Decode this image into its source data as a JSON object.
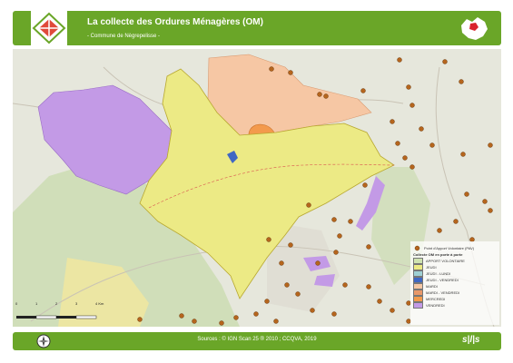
{
  "header": {
    "title": "La collecte des Ordures Ménagères (OM)",
    "subtitle": "- Commune de Nègrepelisse -"
  },
  "footer": {
    "sources": "Sources : © IGN Scan 25 ® 2010 ; CCQVA, 2019",
    "brand": "s|l|s"
  },
  "legend": {
    "pav_label": "Point d'Apport Volontaire (PAV)",
    "group_title": "Collecte OM en porte à porte",
    "items": [
      {
        "label": "APPORT VOLONTAIRE",
        "color": "#cfe3b0"
      },
      {
        "label": "JEUDI",
        "color": "#ecea85"
      },
      {
        "label": "JEUDI - LUNDI",
        "color": "#9fd0d4"
      },
      {
        "label": "JEUDI - VENDREDI",
        "color": "#3f67c4"
      },
      {
        "label": "MARDI",
        "color": "#f6c7a4"
      },
      {
        "label": "MARDI - VENDREDI",
        "color": "#e8986a"
      },
      {
        "label": "MERCREDI",
        "color": "#f39a4c"
      },
      {
        "label": "VENDREDI",
        "color": "#c39ae6"
      }
    ]
  },
  "scale": {
    "ticks": [
      "0",
      "1",
      "2",
      "3",
      "4 Km"
    ]
  },
  "colors": {
    "header_bg": "#6aa628",
    "pav_dot": "#b5651d"
  }
}
